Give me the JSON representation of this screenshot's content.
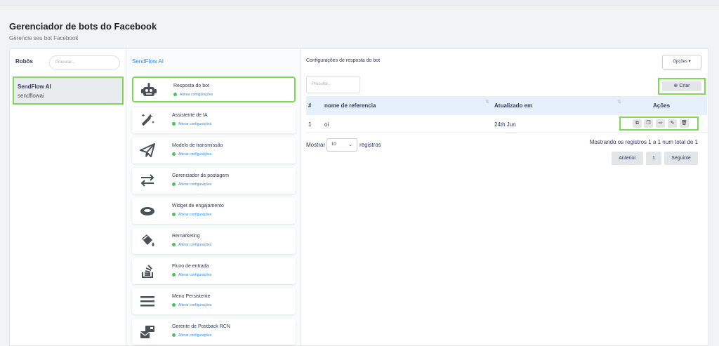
{
  "header": {
    "title": "Gerenciador de bots do Facebook",
    "subtitle": "Gerencie seu bot Facebook"
  },
  "robots": {
    "label": "Robôs",
    "search_placeholder": "Procurar...",
    "items": [
      {
        "name": "SendFlow AI",
        "handle": "sendflowai"
      }
    ]
  },
  "menu": {
    "header": "SendFlow AI",
    "items": [
      {
        "title": "Resposta do bot",
        "sub": "Alterar configurações",
        "icon": "robot-icon"
      },
      {
        "title": "Assistente de IA",
        "sub": "Alterar configurações",
        "icon": "magic-wand-icon"
      },
      {
        "title": "Modelo de transmissão",
        "sub": "Alterar configurações",
        "icon": "paper-plane-icon"
      },
      {
        "title": "Gerenciador de postagem",
        "sub": "Alterar configurações",
        "icon": "exchange-arrows-icon"
      },
      {
        "title": "Widget de engajamento",
        "sub": "Alterar configurações",
        "icon": "ring-icon"
      },
      {
        "title": "Remarketing",
        "sub": "Alterar configurações",
        "icon": "paint-bucket-icon"
      },
      {
        "title": "Fluxo de entrada",
        "sub": "Alterar configurações",
        "icon": "stack-overflow-icon"
      },
      {
        "title": "Menu Persistente",
        "sub": "Alterar configurações",
        "icon": "menu-bars-icon"
      },
      {
        "title": "Gerente de Postback RCN",
        "sub": "Alterar configurações",
        "icon": "mail-bulk-icon"
      }
    ]
  },
  "config": {
    "title": "Configurações de resposta do bot",
    "options_label": "Opções",
    "search_placeholder": "Procurar...",
    "create_label": "Criar",
    "columns": [
      "#",
      "nome de referencia",
      "Atualizado em",
      "Ações"
    ],
    "rows": [
      {
        "num": "1",
        "name": "oi",
        "updated": "24th Jun"
      }
    ],
    "show_label": "Mostrar",
    "show_value": "10",
    "records_label": "registros",
    "info": "Mostrando os registros 1 a 1 num total de 1",
    "pagination": {
      "prev": "Anterior",
      "page": "1",
      "next": "Seguinte"
    }
  },
  "colors": {
    "highlight": "#7ed957",
    "link": "#2d8cf0",
    "status_dot": "#47c363",
    "table_header_bg": "#e6f0fa"
  }
}
